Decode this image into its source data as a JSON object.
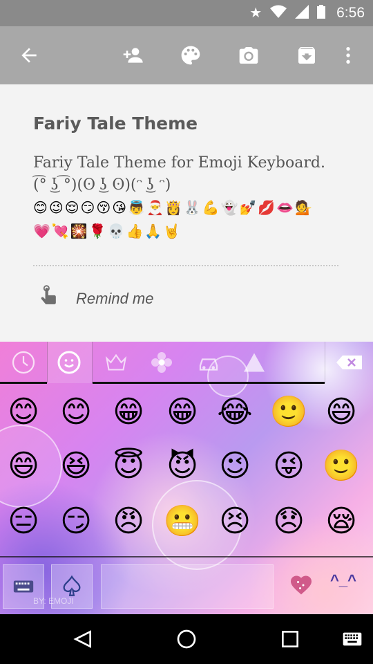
{
  "status_bar": {
    "time": "6:56",
    "icons": [
      "star-icon",
      "wifi-icon",
      "signal-icon",
      "battery-icon"
    ]
  },
  "toolbar": {
    "icons": [
      "back-arrow-icon",
      "add-person-icon",
      "palette-icon",
      "camera-icon",
      "archive-icon",
      "more-vert-icon"
    ]
  },
  "note": {
    "title": "Fariy Tale Theme",
    "body_line1": "Fariy Tale Theme for Emoji Keyboard.",
    "body_line2": "(͡° ͜ʖ ͡°)(ʘ ͜ʖ ʘ)(ᵔ ͜ʖ ᵔ)",
    "emoji_row1": "😊😉😌😏😚😘👼🎅👸🐰💪👻💅💋👄💁",
    "emoji_row2": "💗💘🎇🌹💀👍🙏🤘",
    "remind_label": "Remind me"
  },
  "keyboard": {
    "tabs": [
      "recent-clock-icon",
      "smiley-face-icon",
      "crown-icon",
      "flower-icon",
      "car-icon",
      "triangle-icon"
    ],
    "backspace_icon": "backspace-icon",
    "emoji_rows": [
      [
        "😊",
        "😊",
        "😁",
        "😁",
        "😂",
        "🙂",
        "😄"
      ],
      [
        "😄",
        "😆",
        "😇",
        "😈",
        "😉",
        "😜",
        "🙂"
      ],
      [
        "😑",
        "😏",
        "😠",
        "😬",
        "😣",
        "😞",
        "😪"
      ]
    ],
    "bottom": {
      "keyboard_icon": "keyboard-icon",
      "spade_icon": "spade-icon",
      "byline": "BY: EMOJI",
      "heart_icon": "heart-icon",
      "kaomoji": "^_^"
    }
  },
  "nav_bar": {
    "icons": [
      "back-triangle-icon",
      "home-circle-icon",
      "recents-square-icon",
      "keyboard-switch-icon"
    ]
  }
}
